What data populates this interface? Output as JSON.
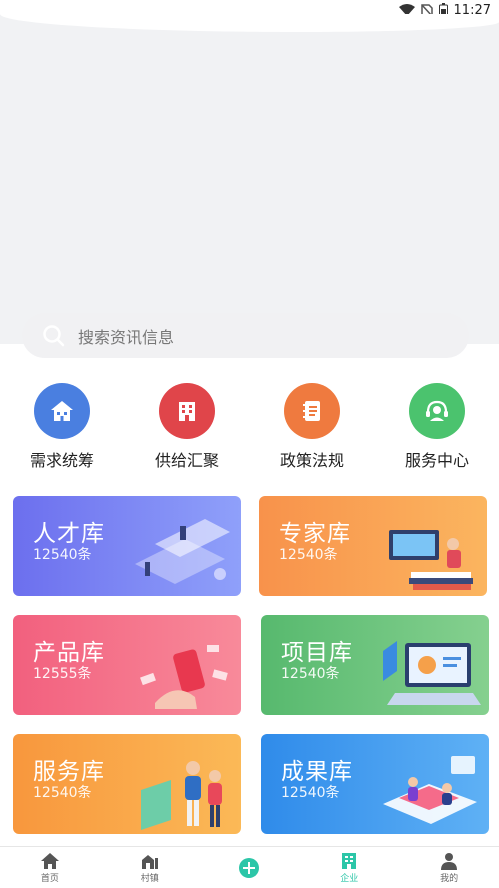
{
  "status_bar": {
    "time": "11:27"
  },
  "search": {
    "placeholder": "搜索资讯信息"
  },
  "quick_links": [
    {
      "label": "需求统筹",
      "color": "#4a7fe0",
      "icon": "house-icon"
    },
    {
      "label": "供给汇聚",
      "color": "#e0454a",
      "icon": "building-icon"
    },
    {
      "label": "政策法规",
      "color": "#ef7a3f",
      "icon": "notebook-icon"
    },
    {
      "label": "服务中心",
      "color": "#4bc36e",
      "icon": "headset-icon"
    }
  ],
  "cards": [
    {
      "title": "人才库",
      "count": "12540条",
      "gradient": [
        "#6c6fee",
        "#8fa0fa"
      ]
    },
    {
      "title": "专家库",
      "count": "12540条",
      "gradient": [
        "#f8924b",
        "#fbb55f"
      ]
    },
    {
      "title": "产品库",
      "count": "12555条",
      "gradient": [
        "#f2607e",
        "#f88a9a"
      ]
    },
    {
      "title": "项目库",
      "count": "12540条",
      "gradient": [
        "#57b96e",
        "#85d08f"
      ]
    },
    {
      "title": "服务库",
      "count": "12540条",
      "gradient": [
        "#f8973d",
        "#fbb957"
      ]
    },
    {
      "title": "成果库",
      "count": "12540条",
      "gradient": [
        "#2f8bea",
        "#5fb1f5"
      ]
    }
  ],
  "tabbar": [
    {
      "label": "首页",
      "icon": "home-icon"
    },
    {
      "label": "村镇",
      "icon": "village-icon"
    },
    {
      "label": "",
      "icon": "plus-circle-icon"
    },
    {
      "label": "企业",
      "icon": "enterprise-icon",
      "active": true
    },
    {
      "label": "我的",
      "icon": "user-icon"
    }
  ]
}
